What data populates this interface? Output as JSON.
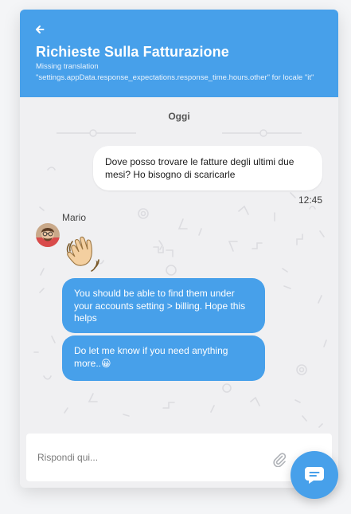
{
  "header": {
    "back_icon": "arrow-left-icon",
    "title": "Richieste Sulla Fatturazione",
    "subtitle": "Missing translation \"settings.appData.response_expectations.response_time.hours.other\" for locale \"it\""
  },
  "conversation": {
    "day_label": "Oggi",
    "outgoing": {
      "text": "Dove posso trovare le fatture degli ultimi due mesi? Ho bisogno di scaricarle",
      "time": "12:45"
    },
    "agent": {
      "name": "Mario",
      "avatar_icon": "agent-avatar",
      "emoji_icon": "waving-hand-icon",
      "messages": [
        "You should be able to find them under your accounts setting > billing. Hope this helps",
        "Do let me know if you need anything more..😀"
      ]
    }
  },
  "composer": {
    "placeholder": "Rispondi qui...",
    "value": "",
    "attach_icon": "paperclip-icon"
  },
  "launcher": {
    "icon": "chat-bubble-icon"
  },
  "colors": {
    "brand": "#47a0ea",
    "chat_background": "#f0f0f2",
    "page_background": "#f4f5f7"
  }
}
